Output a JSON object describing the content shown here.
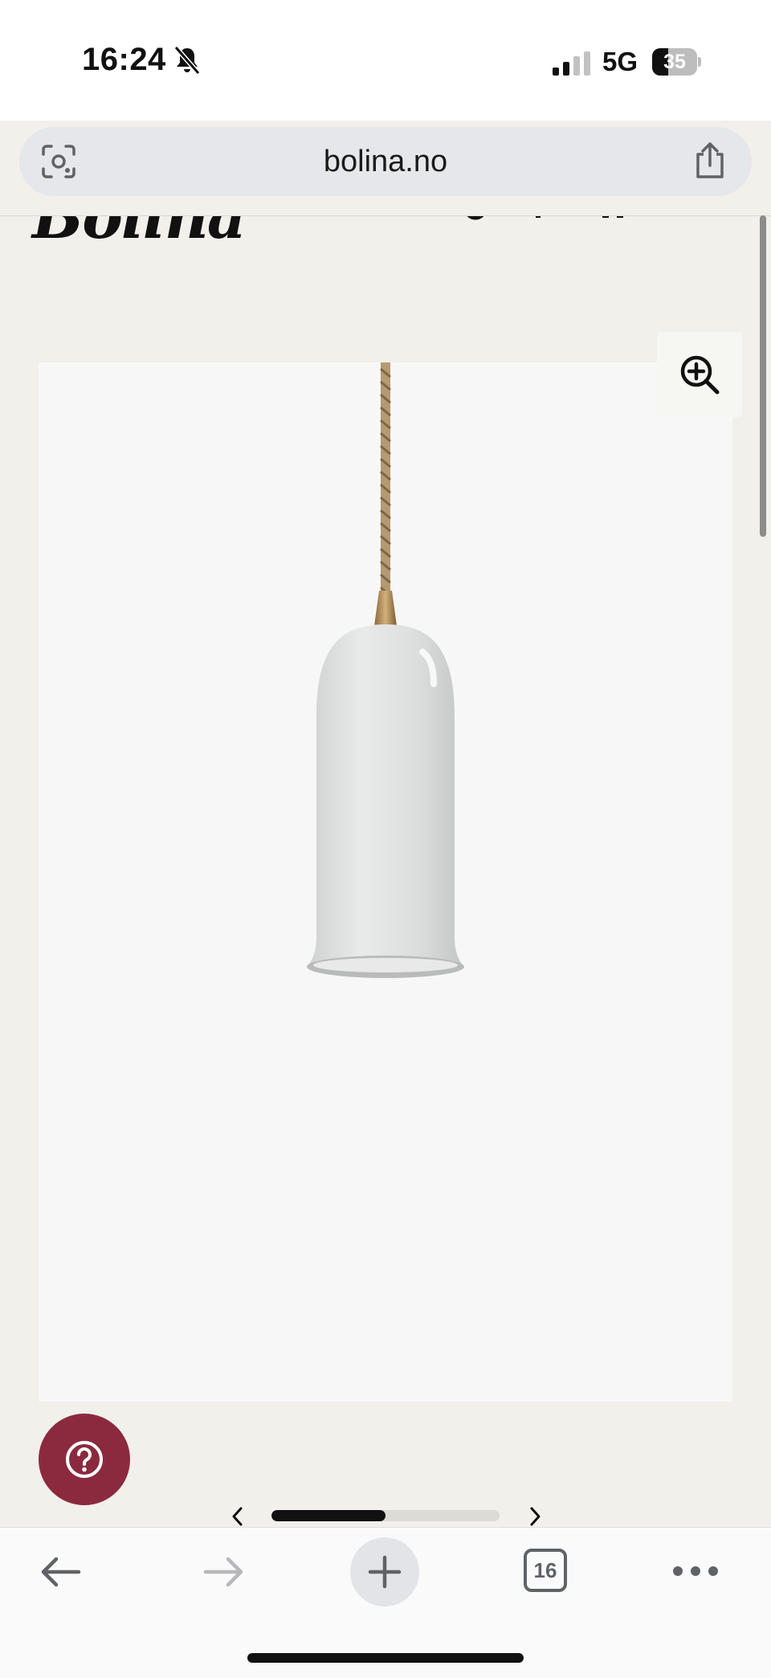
{
  "status_bar": {
    "time": "16:24",
    "network": "5G",
    "battery": "35",
    "battery_level": 0.35,
    "icons": [
      "bell-slash-icon",
      "cellular-signal-icon",
      "battery-icon"
    ]
  },
  "browser": {
    "url": "bolina.no",
    "tab_count": "16",
    "icons": [
      "lens-icon",
      "share-icon",
      "back-arrow-icon",
      "forward-arrow-icon",
      "plus-icon",
      "tabs-icon",
      "more-dots-icon"
    ]
  },
  "site": {
    "logo": "Bolina",
    "gallery": {
      "zoom_icon": "zoom-in-icon",
      "help_icon": "question-icon",
      "progress": 0.5
    }
  },
  "colors": {
    "page_background": "#f1f0eb",
    "image_background": "#f7f7f7",
    "help_button": "#8b2a3e",
    "address_bar": "#e5e7ea"
  }
}
